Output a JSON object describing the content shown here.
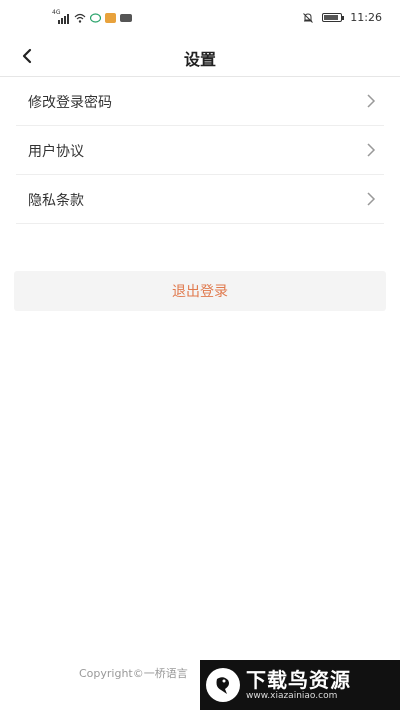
{
  "status_bar": {
    "network": "4G",
    "time": "11:26"
  },
  "header": {
    "title": "设置"
  },
  "menu": {
    "items": [
      {
        "label": "修改登录密码"
      },
      {
        "label": "用户协议"
      },
      {
        "label": "隐私条款"
      }
    ]
  },
  "logout": {
    "label": "退出登录"
  },
  "footer": {
    "copyright": "Copyright©一桥语言"
  },
  "watermark": {
    "title": "下载鸟资源",
    "url": "www.xiazainiao.com"
  },
  "colors": {
    "accent": "#e07a4e",
    "divider": "#eeeeee",
    "button_bg": "#f4f4f4"
  }
}
